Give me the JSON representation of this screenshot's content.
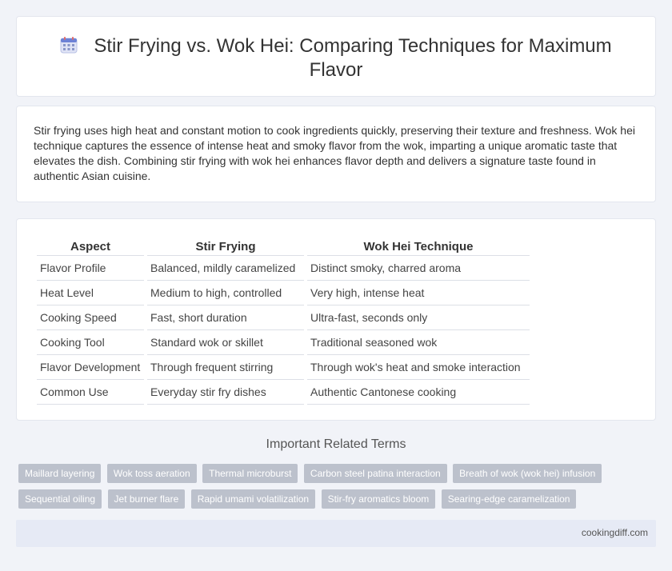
{
  "header": {
    "icon": "calendar-icon",
    "title": "Stir Frying vs. Wok Hei: Comparing Techniques for Maximum Flavor"
  },
  "intro": {
    "text": "Stir frying uses high heat and constant motion to cook ingredients quickly, preserving their texture and freshness. Wok hei technique captures the essence of intense heat and smoky flavor from the wok, imparting a unique aromatic taste that elevates the dish. Combining stir frying with wok hei enhances flavor depth and delivers a signature taste found in authentic Asian cuisine."
  },
  "table": {
    "headers": [
      "Aspect",
      "Stir Frying",
      "Wok Hei Technique"
    ],
    "rows": [
      [
        "Flavor Profile",
        "Balanced, mildly caramelized",
        "Distinct smoky, charred aroma"
      ],
      [
        "Heat Level",
        "Medium to high, controlled",
        "Very high, intense heat"
      ],
      [
        "Cooking Speed",
        "Fast, short duration",
        "Ultra-fast, seconds only"
      ],
      [
        "Cooking Tool",
        "Standard wok or skillet",
        "Traditional seasoned wok"
      ],
      [
        "Flavor Development",
        "Through frequent stirring",
        "Through wok's heat and smoke interaction"
      ],
      [
        "Common Use",
        "Everyday stir fry dishes",
        "Authentic Cantonese cooking"
      ]
    ]
  },
  "related": {
    "title": "Important Related Terms",
    "tags": [
      "Maillard layering",
      "Wok toss aeration",
      "Thermal microburst",
      "Carbon steel patina interaction",
      "Breath of wok (wok hei) infusion",
      "Sequential oiling",
      "Jet burner flare",
      "Rapid umami volatilization",
      "Stir-fry aromatics bloom",
      "Searing-edge caramelization"
    ]
  },
  "footer": {
    "site": "cookingdiff.com"
  },
  "colors": {
    "background": "#f1f3f8",
    "tag": "#bcc1cc",
    "footer": "#e6eaf5"
  }
}
